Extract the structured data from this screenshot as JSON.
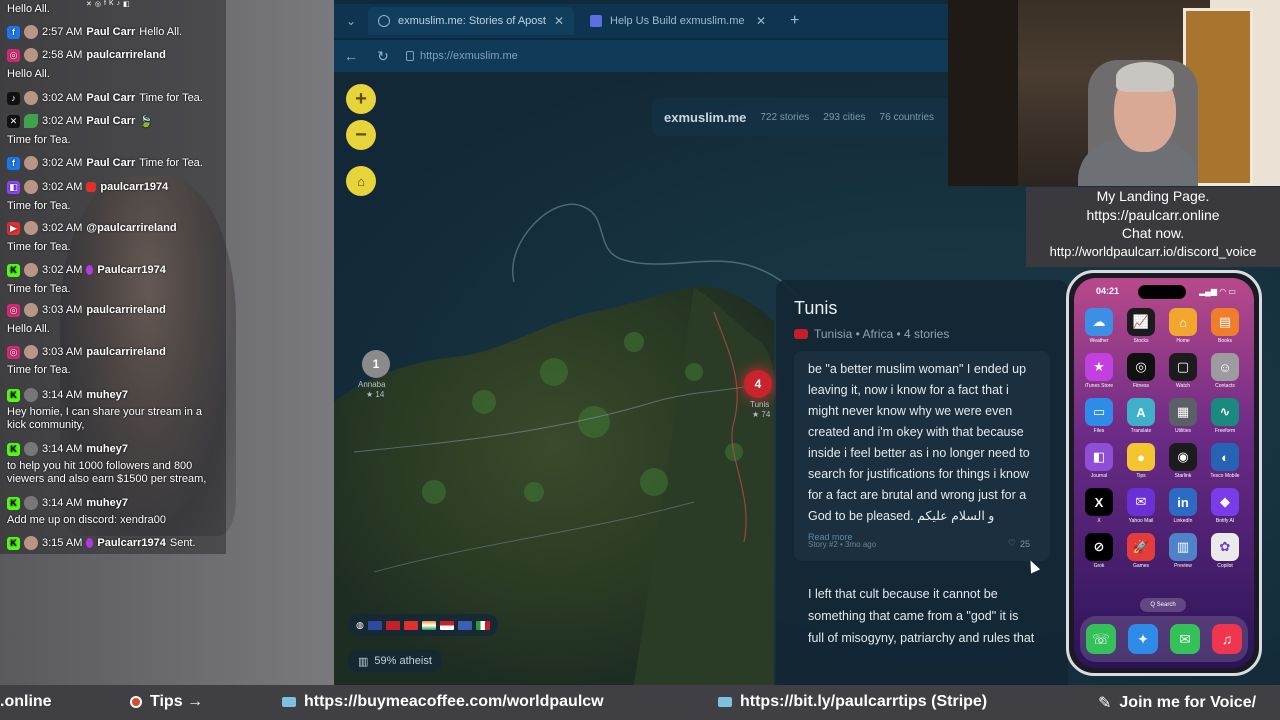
{
  "browser": {
    "tabs": [
      {
        "label": "exmuslim.me: Stories of Apostasy",
        "active": true
      },
      {
        "label": "Help Us Build exmuslim.me",
        "active": false
      }
    ],
    "url": "https://exmuslim.me",
    "brand": "exmuslim.me",
    "stats": {
      "stories": "722 stories",
      "cities": "293 cities",
      "countries": "76 countries"
    }
  },
  "map": {
    "pins": [
      {
        "count": "1",
        "label": "Annaba",
        "sub": "★ 14"
      },
      {
        "count": "4",
        "label": "Tunis",
        "sub": "★ 74"
      }
    ],
    "atheist_stat": "59% atheist"
  },
  "card": {
    "city": "Tunis",
    "country_line": "Tunisia • Africa • 4 stories",
    "story1": "be \"a better muslim woman\" I ended up leaving it, now i know for a fact that i might never know why we were even created and i'm okey with that because inside i feel better as i no longer need to search for justifications for things i know for a fact are brutal and wrong just for a God to be pleased. و السلام عليكم",
    "read_more": "Read more",
    "story1_meta": "Story #2 • 3mo ago",
    "story1_likes": "25",
    "story2": "I left that cult because it cannot be something that came from a \"god\" it is full of misogyny, patriarchy and rules that"
  },
  "chat": {
    "header": "Hello All.",
    "messages": [
      {
        "platform": "facebook",
        "time": "2:57 AM",
        "user": "Paul Carr",
        "msg": "Hello All."
      },
      {
        "platform": "instagram",
        "time": "2:58 AM",
        "user": "paulcarrireland",
        "msg": ""
      },
      {
        "platform": "",
        "time": "",
        "user": "",
        "msg": "Hello All."
      },
      {
        "platform": "tiktok",
        "time": "3:02 AM",
        "user": "Paul Carr",
        "msg": "Time for Tea."
      },
      {
        "platform": "x",
        "time": "3:02 AM",
        "user": "Paul Carr",
        "msg": "🍃"
      },
      {
        "platform": "",
        "time": "",
        "user": "",
        "msg": "Time for Tea."
      },
      {
        "platform": "facebook",
        "time": "3:02 AM",
        "user": "Paul Carr",
        "msg": "Time for Tea."
      },
      {
        "platform": "twitch",
        "time": "3:02 AM",
        "user": "paulcarr1974",
        "msg": ""
      },
      {
        "platform": "",
        "time": "",
        "user": "",
        "msg": "Time for Tea."
      },
      {
        "platform": "youtube",
        "time": "3:02 AM",
        "user": "@paulcarrireland",
        "msg": ""
      },
      {
        "platform": "",
        "time": "",
        "user": "",
        "msg": "Time for Tea."
      },
      {
        "platform": "kick",
        "time": "3:02 AM",
        "user": "Paulcarr1974",
        "msg": ""
      },
      {
        "platform": "",
        "time": "",
        "user": "",
        "msg": "Time for Tea."
      },
      {
        "platform": "instagram",
        "time": "3:03 AM",
        "user": "paulcarrireland",
        "msg": ""
      },
      {
        "platform": "",
        "time": "",
        "user": "",
        "msg": "Hello All."
      },
      {
        "platform": "instagram",
        "time": "3:03 AM",
        "user": "paulcarrireland",
        "msg": ""
      },
      {
        "platform": "",
        "time": "",
        "user": "",
        "msg": "Time for Tea."
      },
      {
        "platform": "kick",
        "time": "3:14 AM",
        "user": "muhey7",
        "msg": ""
      },
      {
        "platform": "",
        "time": "",
        "user": "",
        "msg": "Hey homie, I can share your stream in a"
      },
      {
        "platform": "",
        "time": "",
        "user": "",
        "msg": "kick community,"
      },
      {
        "platform": "kick",
        "time": "3:14 AM",
        "user": "muhey7",
        "msg": ""
      },
      {
        "platform": "",
        "time": "",
        "user": "",
        "msg": "to help you hit 1000 followers and 800"
      },
      {
        "platform": "",
        "time": "",
        "user": "",
        "msg": "viewers and also earn $1500 per stream,"
      },
      {
        "platform": "kick",
        "time": "3:14 AM",
        "user": "muhey7",
        "msg": ""
      },
      {
        "platform": "",
        "time": "",
        "user": "",
        "msg": "Add me up on discord: xendra00"
      },
      {
        "platform": "kick",
        "time": "3:15 AM",
        "user": "Paulcarr1974",
        "msg": "Sent."
      }
    ]
  },
  "landing": {
    "line1": "My Landing Page.",
    "line2": "https://paulcarr.online",
    "line3": "Chat now.",
    "line4": "http://worldpaulcarr.io/discord_voice"
  },
  "phone": {
    "time": "04:21",
    "apps": [
      {
        "name": "Weather",
        "icon": "☁",
        "color": "#3b8fe6"
      },
      {
        "name": "Stocks",
        "icon": "📈",
        "color": "#1c1c1e"
      },
      {
        "name": "Home",
        "icon": "⌂",
        "color": "#f3a62c"
      },
      {
        "name": "Books",
        "icon": "▤",
        "color": "#f07d2a"
      },
      {
        "name": "iTunes Store",
        "icon": "★",
        "color": "#c23fe0"
      },
      {
        "name": "Fitness",
        "icon": "◎",
        "color": "#111"
      },
      {
        "name": "Watch",
        "icon": "▢",
        "color": "#1c1c1e"
      },
      {
        "name": "Contacts",
        "icon": "☺",
        "color": "#9b9ba0"
      },
      {
        "name": "Files",
        "icon": "▭",
        "color": "#2f8be8"
      },
      {
        "name": "Translate",
        "icon": "A",
        "color": "#3fb0c9"
      },
      {
        "name": "Utilities",
        "icon": "▦",
        "color": "#5b5f66"
      },
      {
        "name": "Freeform",
        "icon": "∿",
        "color": "#1a8a7e"
      },
      {
        "name": "Journal",
        "icon": "◧",
        "color": "#8e4fd6"
      },
      {
        "name": "Tips",
        "icon": "●",
        "color": "#f3c531"
      },
      {
        "name": "Starlink",
        "icon": "◉",
        "color": "#1c1c1e"
      },
      {
        "name": "Tesco Mobile",
        "icon": "◐",
        "color": "#2663b5"
      },
      {
        "name": "X",
        "icon": "X",
        "color": "#000"
      },
      {
        "name": "Yahoo Mail",
        "icon": "✉",
        "color": "#6b2fd6"
      },
      {
        "name": "LinkedIn",
        "icon": "in",
        "color": "#2d6ac4"
      },
      {
        "name": "Botify AI",
        "icon": "◆",
        "color": "#7a3be8"
      },
      {
        "name": "Grok",
        "icon": "⊘",
        "color": "#000"
      },
      {
        "name": "Games",
        "icon": "🚀",
        "color": "#e43b3b"
      },
      {
        "name": "Preview",
        "icon": "▥",
        "color": "#4e83c9"
      },
      {
        "name": "Copilot",
        "icon": "✿",
        "color": "#eaeaea"
      }
    ],
    "search": "Q Search",
    "dock": [
      {
        "name": "phone",
        "icon": "☏",
        "color": "#35c15a"
      },
      {
        "name": "safari",
        "icon": "✦",
        "color": "#2f8be8"
      },
      {
        "name": "messages",
        "icon": "✉",
        "color": "#35c15a"
      },
      {
        "name": "music",
        "icon": "♫",
        "color": "#f0364f"
      }
    ]
  },
  "ticker": {
    "seg1": ".online",
    "seg2": "Tips →",
    "seg3": "https://buymeacoffee.com/worldpaulcw",
    "seg4": "https://bit.ly/paulcarrtips (Stripe)",
    "seg5": "Join me for Voice/"
  }
}
